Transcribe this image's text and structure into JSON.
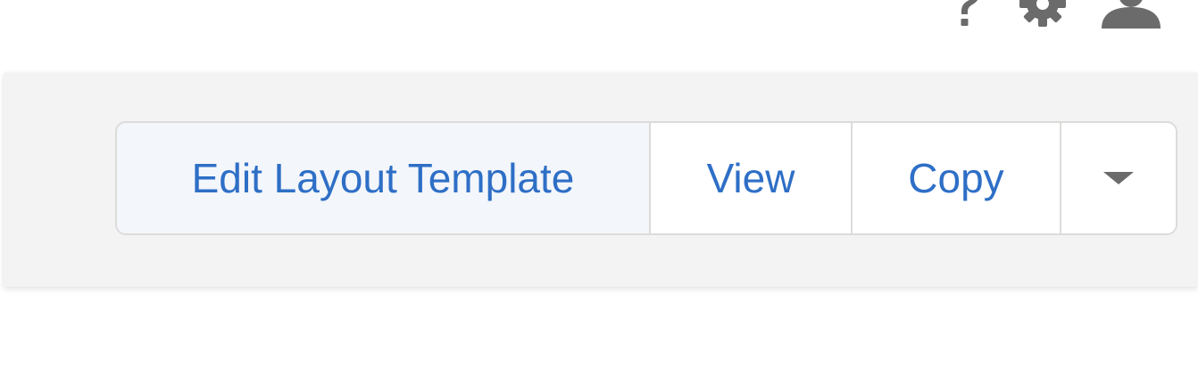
{
  "header": {
    "icons": [
      "help-icon",
      "gear-icon",
      "user-icon"
    ]
  },
  "actions": {
    "edit_label": "Edit Layout Template",
    "view_label": "View",
    "copy_label": "Copy",
    "more_icon": "chevron-down-icon"
  },
  "colors": {
    "link": "#2e6fc6",
    "bar_background": "#f3f3f3",
    "border": "#dddbda",
    "icon": "#6b6b6b"
  }
}
